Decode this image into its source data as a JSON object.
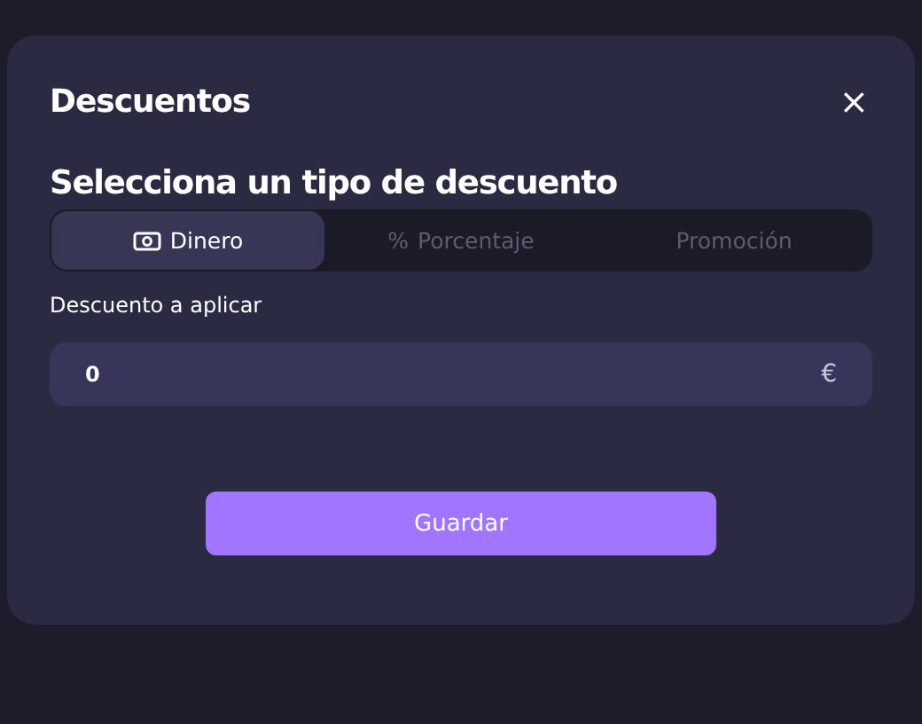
{
  "dialog": {
    "title": "Descuentos",
    "close": "×"
  },
  "section": {
    "heading": "Selecciona un tipo de descuento"
  },
  "tabs": [
    {
      "label": "Dinero",
      "kind": "cash",
      "selected": true
    },
    {
      "label": "Porcentaje",
      "kind": "symbol",
      "symbol": "%",
      "selected": false
    },
    {
      "label": "Promoción",
      "kind": "plain",
      "selected": false
    }
  ],
  "field": {
    "label": "Descuento a aplicar",
    "value": "0",
    "suffix": "€"
  },
  "buttons": [
    "Guardar"
  ]
}
